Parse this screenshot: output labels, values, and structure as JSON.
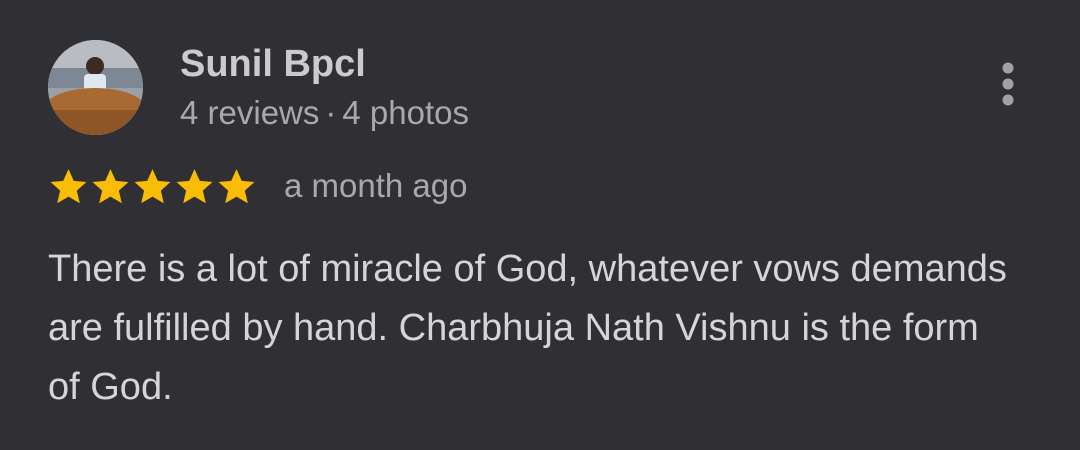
{
  "review": {
    "author": {
      "name": "Sunil Bpcl",
      "reviews": "4 reviews",
      "separator": "·",
      "photos": "4 photos"
    },
    "rating": 5,
    "rating_max": 5,
    "date": "a month ago",
    "text": "There is a lot of miracle of God, whatever vows demands are fulfilled by hand. Charbhuja Nath Vishnu is the form of God."
  },
  "icons": {
    "star": "star-icon",
    "more": "more-vert-icon"
  },
  "colors": {
    "background": "#303034",
    "star": "#FBBC04",
    "name": "#c9cbd0",
    "secondary": "#a7a9ae",
    "body": "#d3d5da"
  }
}
